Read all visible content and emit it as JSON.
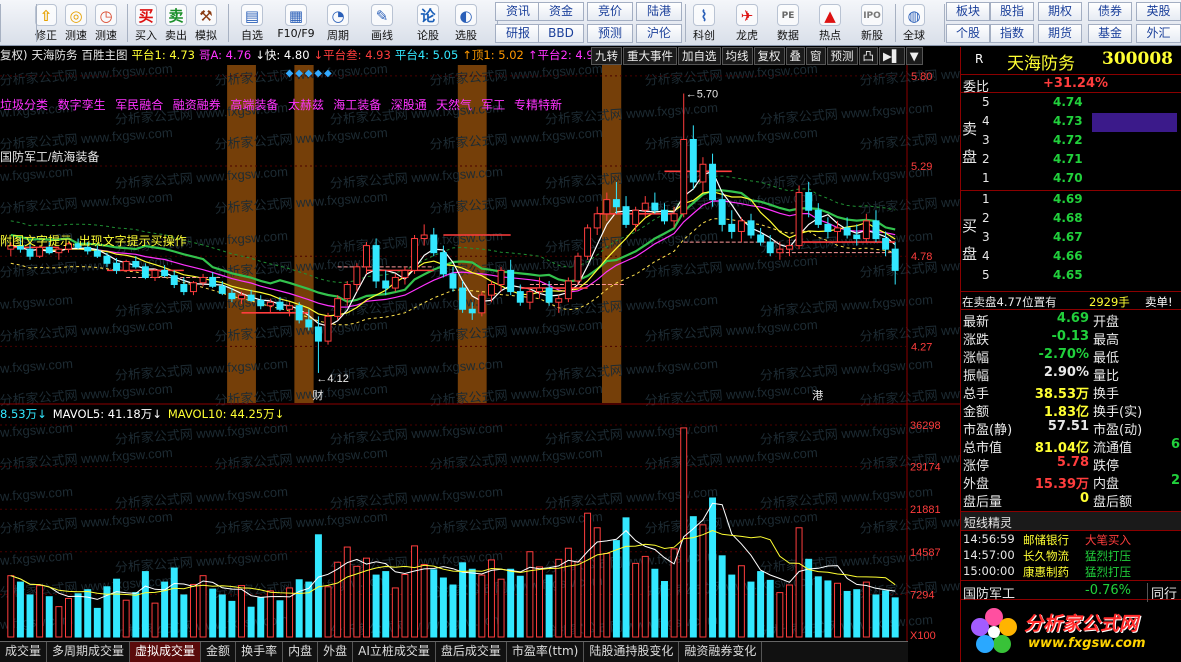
{
  "colors": {
    "up": "#ff3d3d",
    "down": "#33e8ff",
    "bg": "#000000",
    "ma5": "#ffffff",
    "ma10": "#ffff33",
    "ma20": "#ff33ff",
    "upper": "#33c24d",
    "highlight": "#8a4a0a"
  },
  "toolbar": {
    "buttons": [
      {
        "label": "修正",
        "icon": "up-arrow-icon",
        "glyph": "⇧",
        "x": 36
      },
      {
        "label": "测速",
        "icon": "speed-icon",
        "glyph": "◎",
        "x": 66
      },
      {
        "label": "测速",
        "icon": "clock-icon",
        "glyph": "◷",
        "x": 96
      },
      {
        "label": "买入",
        "icon": "buy-icon",
        "glyph": "买",
        "x": 131
      },
      {
        "label": "卖出",
        "icon": "sell-icon",
        "glyph": "卖",
        "x": 162
      },
      {
        "label": "模拟",
        "icon": "hammer-icon",
        "glyph": "⚒",
        "x": 193
      },
      {
        "label": "自选",
        "icon": "watchlist-icon",
        "glyph": "▤",
        "x": 233
      },
      {
        "label": "F10/F9",
        "icon": "f10-icon",
        "glyph": "▦",
        "x": 273
      },
      {
        "label": "周期",
        "icon": "period-icon",
        "glyph": "◔",
        "x": 320
      },
      {
        "label": "画线",
        "icon": "pen-icon",
        "glyph": "✎",
        "x": 365
      },
      {
        "label": "论股",
        "icon": "discuss-icon",
        "glyph": "论",
        "x": 410
      },
      {
        "label": "选股",
        "icon": "select-stock-icon",
        "glyph": "◐",
        "x": 450
      },
      {
        "label": "科创",
        "icon": "kechuang-icon",
        "glyph": "⌇",
        "x": 690
      },
      {
        "label": "龙虎",
        "icon": "dragon-tiger-icon",
        "glyph": "✈",
        "x": 735
      },
      {
        "label": "数据",
        "icon": "data-icon",
        "glyph": "PE",
        "x": 776
      },
      {
        "label": "热点",
        "icon": "hot-icon",
        "glyph": "▲",
        "x": 816
      },
      {
        "label": "新股",
        "icon": "new-stock-icon",
        "glyph": "IPO",
        "x": 858
      },
      {
        "label": "全球",
        "icon": "globe-icon",
        "glyph": "◍",
        "x": 903
      }
    ],
    "grid": [
      [
        "资讯",
        "资金",
        "竞价",
        "陆港"
      ],
      [
        "研报",
        "BBD",
        "预测",
        "沪伦"
      ]
    ],
    "grid2": [
      [
        "板块",
        "股指",
        "期权",
        "债券",
        "英股"
      ],
      [
        "个股",
        "指数",
        "期货",
        "基金",
        "外汇"
      ]
    ]
  },
  "chart": {
    "header": [
      {
        "text": "复权)",
        "color": "#e8e8e8"
      },
      {
        "text": "天海防务",
        "color": "#e8e8e8"
      },
      {
        "text": "百胜主图",
        "color": "#e8e8e8"
      },
      {
        "text": "平台1: 4.73",
        "color": "#ffff33"
      },
      {
        "text": "哥A: 4.76",
        "color": "#ff33ff"
      },
      {
        "text": "↓快: 4.80",
        "color": "#ffffff"
      },
      {
        "text": "↓平台叁: 4.93",
        "color": "#ff3d3d"
      },
      {
        "text": "平台4: 5.05",
        "color": "#33e8ff"
      },
      {
        "text": "↑顶1: 5.02",
        "color": "#ff9900"
      },
      {
        "text": "↑平台2: 4.9",
        "color": "#ff33ff"
      }
    ],
    "tabs": [
      "九转",
      "重大事件",
      "加自选",
      "均线",
      "复权",
      "叠",
      "窗",
      "预测",
      "凸",
      "▶▌",
      "▼"
    ],
    "y_ticks": [
      "5.80",
      "5.29",
      "4.78",
      "4.27"
    ],
    "concepts": [
      "垃圾分类",
      "数字孪生",
      "军民融合",
      "融资融券",
      "高端装备",
      "太赫兹",
      "海工装备",
      "深股通",
      "天然气",
      "军工",
      "专精特新"
    ],
    "industry": "国防军工/航海装备",
    "hint": "附图文字提示, 出现文字提示买操作",
    "max_label": "5.70",
    "min_label": "4.12",
    "markers": [
      "财",
      "港"
    ],
    "watermark": "分析家公式网 www.fxgsw.com"
  },
  "chart_data": {
    "type": "candlestick",
    "ylim": [
      3.95,
      5.85
    ],
    "candles": [
      [
        4.82,
        4.86,
        4.78,
        4.84
      ],
      [
        4.84,
        4.88,
        4.8,
        4.82
      ],
      [
        4.82,
        4.85,
        4.76,
        4.78
      ],
      [
        4.78,
        4.84,
        4.77,
        4.83
      ],
      [
        4.83,
        4.86,
        4.79,
        4.8
      ],
      [
        4.8,
        4.83,
        4.76,
        4.82
      ],
      [
        4.82,
        4.86,
        4.8,
        4.85
      ],
      [
        4.85,
        4.88,
        4.82,
        4.83
      ],
      [
        4.83,
        4.86,
        4.79,
        4.81
      ],
      [
        4.81,
        4.84,
        4.77,
        4.78
      ],
      [
        4.78,
        4.8,
        4.72,
        4.74
      ],
      [
        4.74,
        4.77,
        4.68,
        4.7
      ],
      [
        4.7,
        4.76,
        4.69,
        4.75
      ],
      [
        4.75,
        4.78,
        4.71,
        4.72
      ],
      [
        4.72,
        4.74,
        4.65,
        4.66
      ],
      [
        4.66,
        4.71,
        4.64,
        4.7
      ],
      [
        4.7,
        4.73,
        4.66,
        4.67
      ],
      [
        4.67,
        4.7,
        4.6,
        4.62
      ],
      [
        4.62,
        4.66,
        4.56,
        4.58
      ],
      [
        4.58,
        4.64,
        4.56,
        4.63
      ],
      [
        4.63,
        4.68,
        4.61,
        4.66
      ],
      [
        4.66,
        4.69,
        4.6,
        4.61
      ],
      [
        4.61,
        4.64,
        4.56,
        4.57
      ],
      [
        4.57,
        4.6,
        4.52,
        4.54
      ],
      [
        4.54,
        4.58,
        4.51,
        4.56
      ],
      [
        4.56,
        4.59,
        4.52,
        4.53
      ],
      [
        4.53,
        4.56,
        4.48,
        4.5
      ],
      [
        4.5,
        4.54,
        4.46,
        4.52
      ],
      [
        4.52,
        4.55,
        4.47,
        4.48
      ],
      [
        4.48,
        4.52,
        4.44,
        4.5
      ],
      [
        4.5,
        4.52,
        4.4,
        4.42
      ],
      [
        4.42,
        4.48,
        4.36,
        4.38
      ],
      [
        4.38,
        4.44,
        4.12,
        4.3
      ],
      [
        4.3,
        4.46,
        4.28,
        4.44
      ],
      [
        4.44,
        4.56,
        4.42,
        4.54
      ],
      [
        4.54,
        4.64,
        4.5,
        4.62
      ],
      [
        4.62,
        4.74,
        4.58,
        4.72
      ],
      [
        4.72,
        4.86,
        4.68,
        4.84
      ],
      [
        4.84,
        4.88,
        4.6,
        4.64
      ],
      [
        4.64,
        4.7,
        4.56,
        4.6
      ],
      [
        4.6,
        4.68,
        4.58,
        4.66
      ],
      [
        4.66,
        4.72,
        4.62,
        4.7
      ],
      [
        4.7,
        4.9,
        4.68,
        4.88
      ],
      [
        4.88,
        4.96,
        4.84,
        4.9
      ],
      [
        4.9,
        4.94,
        4.78,
        4.8
      ],
      [
        4.8,
        4.84,
        4.66,
        4.68
      ],
      [
        4.68,
        4.72,
        4.58,
        4.6
      ],
      [
        4.6,
        4.64,
        4.46,
        4.48
      ],
      [
        4.48,
        4.52,
        4.42,
        4.46
      ],
      [
        4.46,
        4.58,
        4.44,
        4.56
      ],
      [
        4.56,
        4.64,
        4.52,
        4.62
      ],
      [
        4.62,
        4.72,
        4.58,
        4.7
      ],
      [
        4.7,
        4.76,
        4.56,
        4.58
      ],
      [
        4.58,
        4.62,
        4.5,
        4.52
      ],
      [
        4.52,
        4.6,
        4.48,
        4.58
      ],
      [
        4.58,
        4.66,
        4.54,
        4.6
      ],
      [
        4.6,
        4.64,
        4.5,
        4.52
      ],
      [
        4.52,
        4.56,
        4.46,
        4.54
      ],
      [
        4.54,
        4.66,
        4.52,
        4.64
      ],
      [
        4.64,
        4.8,
        4.62,
        4.78
      ],
      [
        4.78,
        4.96,
        4.76,
        4.94
      ],
      [
        4.94,
        5.06,
        4.9,
        5.02
      ],
      [
        5.02,
        5.14,
        4.98,
        5.1
      ],
      [
        5.1,
        5.2,
        5.02,
        5.06
      ],
      [
        5.06,
        5.12,
        4.94,
        4.96
      ],
      [
        4.96,
        5.06,
        4.92,
        5.04
      ],
      [
        5.04,
        5.12,
        5.0,
        5.08
      ],
      [
        5.08,
        5.14,
        5.02,
        5.04
      ],
      [
        5.04,
        5.08,
        4.96,
        4.98
      ],
      [
        4.98,
        5.06,
        4.94,
        5.02
      ],
      [
        5.02,
        5.7,
        5.0,
        5.44
      ],
      [
        5.44,
        5.52,
        5.16,
        5.2
      ],
      [
        5.2,
        5.34,
        5.14,
        5.3
      ],
      [
        5.3,
        5.36,
        5.06,
        5.1
      ],
      [
        5.1,
        5.14,
        4.92,
        4.96
      ],
      [
        4.96,
        5.04,
        4.88,
        4.92
      ],
      [
        4.92,
        5.0,
        4.86,
        4.98
      ],
      [
        4.98,
        5.02,
        4.88,
        4.9
      ],
      [
        4.9,
        4.94,
        4.84,
        4.86
      ],
      [
        4.86,
        4.9,
        4.78,
        4.8
      ],
      [
        4.8,
        4.86,
        4.76,
        4.82
      ],
      [
        4.82,
        4.88,
        4.78,
        4.84
      ],
      [
        4.84,
        5.18,
        4.82,
        5.14
      ],
      [
        5.14,
        5.2,
        5.0,
        5.04
      ],
      [
        5.04,
        5.08,
        4.94,
        4.96
      ],
      [
        4.96,
        5.0,
        4.88,
        4.92
      ],
      [
        4.92,
        4.98,
        4.86,
        4.94
      ],
      [
        4.94,
        5.0,
        4.88,
        4.9
      ],
      [
        4.9,
        4.96,
        4.84,
        4.88
      ],
      [
        4.88,
        5.02,
        4.86,
        4.98
      ],
      [
        4.98,
        5.04,
        4.86,
        4.88
      ],
      [
        4.88,
        4.92,
        4.78,
        4.82
      ],
      [
        4.82,
        4.86,
        4.62,
        4.7
      ]
    ],
    "volumes": [
      10500,
      9400,
      7200,
      8800,
      6900,
      5200,
      6600,
      7400,
      8100,
      4900,
      8600,
      9900,
      6300,
      7600,
      11200,
      5800,
      9400,
      11800,
      7200,
      9000,
      10500,
      8200,
      7200,
      6100,
      8800,
      5100,
      6700,
      7900,
      6200,
      8400,
      9800,
      9400,
      17500,
      8600,
      12800,
      15400,
      12100,
      13500,
      10600,
      11200,
      8400,
      10700,
      15600,
      12400,
      11500,
      10100,
      8900,
      12700,
      11600,
      10600,
      13200,
      9900,
      11600,
      10400,
      14600,
      12000,
      10600,
      13300,
      15200,
      12900,
      21200,
      18700,
      14300,
      16500,
      20400,
      12600,
      13800,
      11600,
      9500,
      15100,
      35800,
      20600,
      19200,
      23800,
      13900,
      10600,
      12200,
      9400,
      11200,
      9700,
      7600,
      8900,
      18700,
      13300,
      10300,
      9600,
      9200,
      7800,
      8100,
      9400,
      7200,
      7900,
      6700
    ],
    "vol_ylim": [
      0,
      36298
    ],
    "vol_ticks": [
      "36298",
      "29174",
      "21881",
      "14587",
      "7294",
      "X100"
    ],
    "highlight_ranges": [
      [
        23,
        25
      ],
      [
        30,
        31
      ],
      [
        47,
        49
      ],
      [
        62,
        63
      ]
    ]
  },
  "volume_header": [
    {
      "text": "8.53万↓",
      "color": "#33e8ff"
    },
    {
      "text": "MAVOL5: 41.18万↓",
      "color": "#ffffff"
    },
    {
      "text": "MAVOL10: 44.25万↓",
      "color": "#ffff33"
    }
  ],
  "bottom_tabs": [
    "成交量",
    "多周期成交量",
    "虚拟成交量",
    "金额",
    "换手率",
    "内盘",
    "外盘",
    "AI立桩成交量",
    "盘后成交量",
    "市盈率(ttm)",
    "陆股通持股变化",
    "融资融券变化"
  ],
  "bottom_active": 2,
  "panel": {
    "r_label": "R",
    "stock_name": "天海防务",
    "stock_code": "300008",
    "weibi_label": "委比",
    "weibi": "+31.24%",
    "sell_label": "卖盘",
    "buy_label": "买盘",
    "asks": [
      {
        "lvl": "5",
        "price": "4.74",
        "vol": ""
      },
      {
        "lvl": "4",
        "price": "4.73",
        "vol": ""
      },
      {
        "lvl": "3",
        "price": "4.72",
        "vol": ""
      },
      {
        "lvl": "2",
        "price": "4.71",
        "vol": ""
      },
      {
        "lvl": "1",
        "price": "4.70",
        "vol": ""
      }
    ],
    "bids": [
      {
        "lvl": "1",
        "price": "4.69",
        "vol": ""
      },
      {
        "lvl": "2",
        "price": "4.68",
        "vol": ""
      },
      {
        "lvl": "3",
        "price": "4.67",
        "vol": ""
      },
      {
        "lvl": "4",
        "price": "4.66",
        "vol": ""
      },
      {
        "lvl": "5",
        "price": "4.65",
        "vol": ""
      }
    ],
    "sell_note": "在卖盘4.77位置有",
    "sell_note_vol": "2929手",
    "sell_note_tag": "卖单!",
    "stats": [
      {
        "l1": "最新",
        "v1": "4.69",
        "c1": "green",
        "l2": "开盘",
        "v2": ""
      },
      {
        "l1": "涨跌",
        "v1": "-0.13",
        "c1": "green",
        "l2": "最高",
        "v2": ""
      },
      {
        "l1": "涨幅",
        "v1": "-2.70%",
        "c1": "green",
        "l2": "最低",
        "v2": ""
      },
      {
        "l1": "振幅",
        "v1": "2.90%",
        "c1": "white",
        "l2": "量比",
        "v2": ""
      },
      {
        "l1": "总手",
        "v1": "38.53万",
        "c1": "yellow",
        "l2": "换手",
        "v2": ""
      },
      {
        "l1": "金额",
        "v1": "1.83亿",
        "c1": "yellow",
        "l2": "换手(实)",
        "v2": ""
      },
      {
        "l1": "市盈(静)",
        "v1": "57.51",
        "c1": "white",
        "l2": "市盈(动)",
        "v2": ""
      },
      {
        "l1": "总市值",
        "v1": "81.04亿",
        "c1": "yellow",
        "l2": "流通值",
        "v2": "6"
      },
      {
        "l1": "涨停",
        "v1": "5.78",
        "c1": "red",
        "l2": "跌停",
        "v2": ""
      },
      {
        "l1": "外盘",
        "v1": "15.39万",
        "c1": "red",
        "l2": "内盘",
        "v2": "2"
      },
      {
        "l1": "盘后量",
        "v1": "0",
        "c1": "yellow",
        "l2": "盘后额",
        "v2": ""
      }
    ],
    "short_title": "短线精灵",
    "short_items": [
      {
        "time": "14:56:59",
        "name": "邮储银行",
        "action": "大笔买入",
        "color": "red"
      },
      {
        "time": "14:57:00",
        "name": "长久物流",
        "action": "猛烈打压",
        "color": "green"
      },
      {
        "time": "15:00:00",
        "name": "康惠制药",
        "action": "猛烈打压",
        "color": "green"
      }
    ],
    "sector_name": "国防军工",
    "sector_change": "-0.76%",
    "sector_tab": "同行"
  },
  "logo": {
    "text": "分析家公式网",
    "url": "www.fxgsw.com"
  }
}
